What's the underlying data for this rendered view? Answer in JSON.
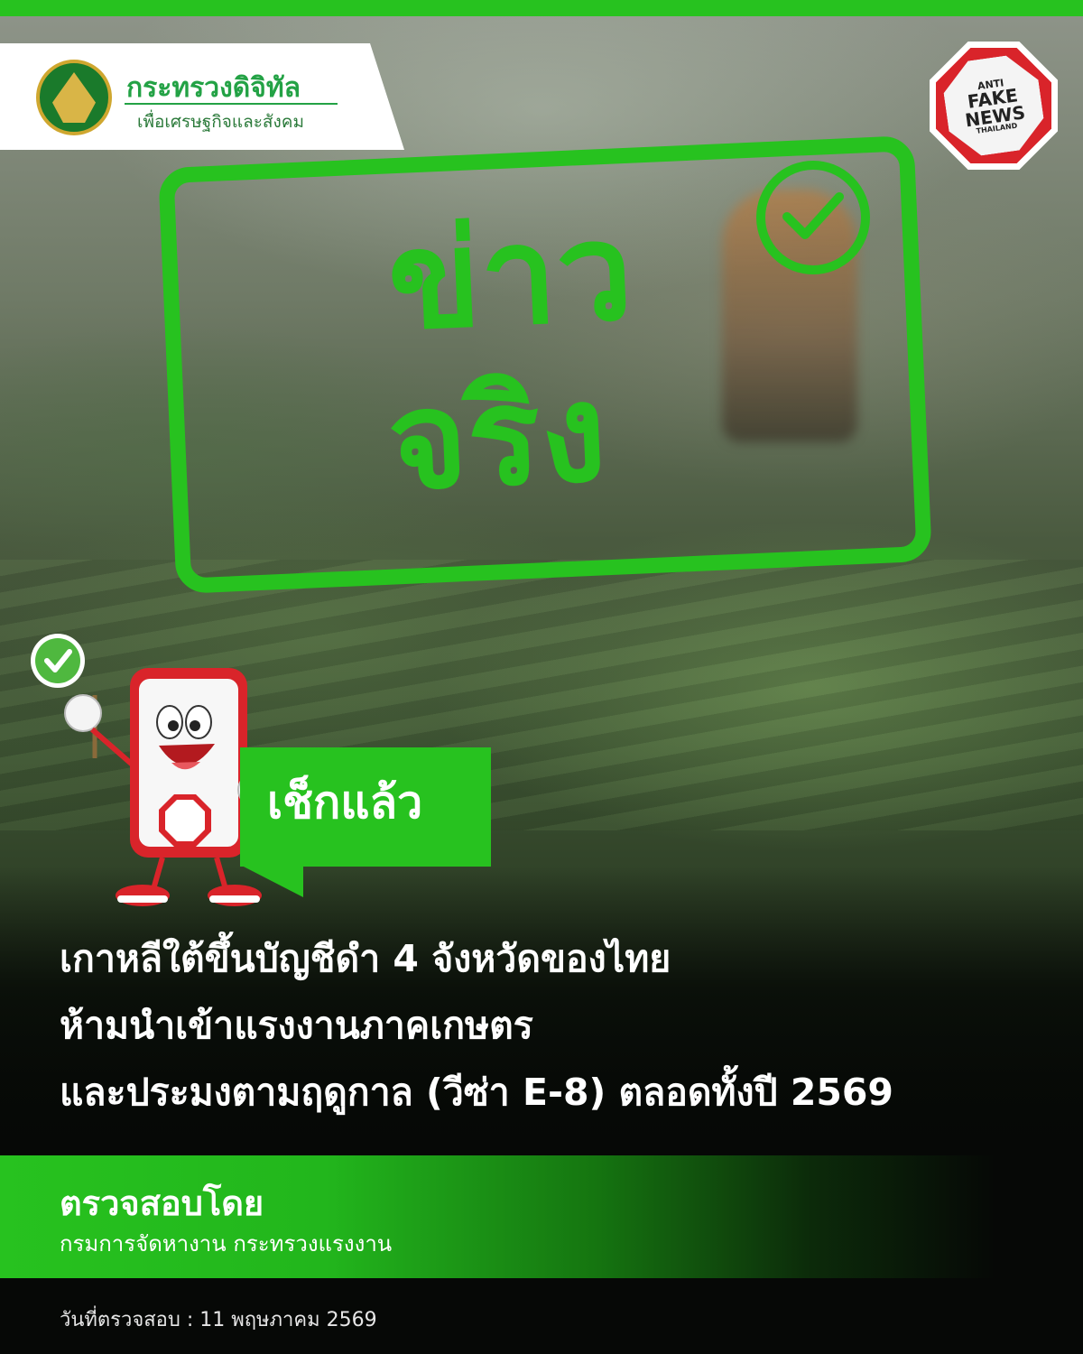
{
  "header": {
    "ministry_name": "กระทรวงดิจิทัล",
    "ministry_subtitle": "เพื่อเศรษฐกิจและสังคม",
    "anti_fake_news": {
      "line1": "ANTI",
      "line2": "FAKE",
      "line3": "NEWS",
      "line4": "THAILAND"
    }
  },
  "stamp": {
    "line1": "ข่าว",
    "line2": "จริง",
    "icon": "check-circle-icon"
  },
  "badge": {
    "label": "เช็กแล้ว"
  },
  "headline": {
    "lines": [
      "เกาหลีใต้ขึ้นบัญชีดำ 4 จังหวัดของไทย",
      "ห้ามนำเข้าแรงงานภาคเกษตร",
      "และประมงตามฤดูกาล (วีซ่า E-8) ตลอดทั้งปี 2569"
    ]
  },
  "verification": {
    "title": "ตรวจสอบโดย",
    "organization": "กรมการจัดหางาน กระทรวงแรงงาน",
    "date_line": "วันที่ตรวจสอบ : 11 พฤษภาคม 2569"
  },
  "colors": {
    "accent_green": "#27c21f",
    "alert_red": "#d9242a",
    "text_white": "#ffffff"
  }
}
